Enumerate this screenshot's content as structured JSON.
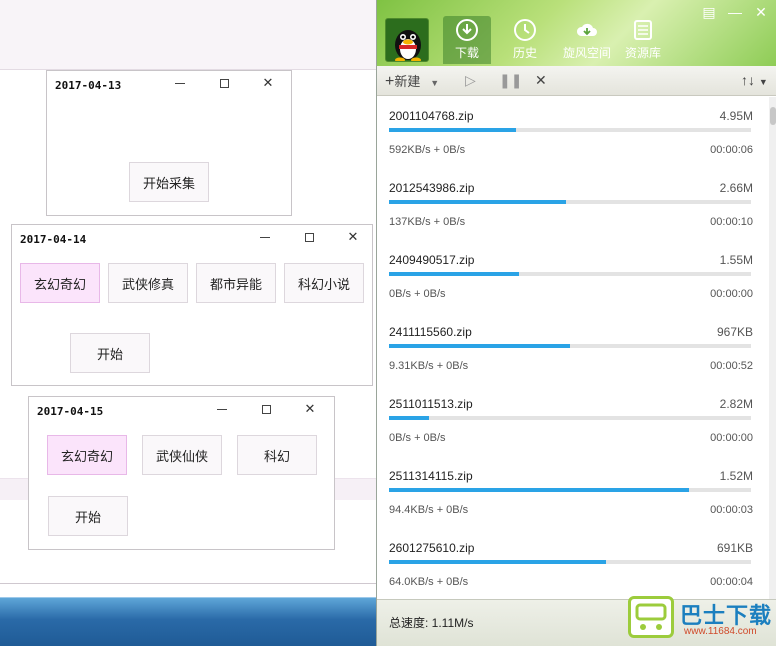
{
  "windows": [
    {
      "title": "2017-04-13",
      "buttons": [
        "开始采集"
      ]
    },
    {
      "title": "2017-04-14",
      "categories": [
        "玄幻奇幻",
        "武侠修真",
        "都市异能",
        "科幻小说"
      ],
      "start": "开始"
    },
    {
      "title": "2017-04-15",
      "categories": [
        "玄幻奇幻",
        "武侠仙侠",
        "科幻"
      ],
      "start": "开始"
    }
  ],
  "download_manager": {
    "nav": [
      {
        "label": "下载",
        "icon": "download-icon"
      },
      {
        "label": "历史",
        "icon": "clock-icon"
      },
      {
        "label": "旋风空间",
        "icon": "cloud-icon"
      },
      {
        "label": "资源库",
        "icon": "library-icon"
      }
    ],
    "toolbar": {
      "new_label": "新建",
      "sort_label": "↑↓"
    },
    "items": [
      {
        "name": "2001104768.zip",
        "size": "4.95M",
        "progress": 0.35,
        "speed": "592KB/s + 0B/s",
        "eta": "00:00:06"
      },
      {
        "name": "2012543986.zip",
        "size": "2.66M",
        "progress": 0.49,
        "speed": "137KB/s + 0B/s",
        "eta": "00:00:10"
      },
      {
        "name": "2409490517.zip",
        "size": "1.55M",
        "progress": 0.36,
        "speed": "0B/s + 0B/s",
        "eta": "00:00:00"
      },
      {
        "name": "2411115560.zip",
        "size": "967KB",
        "progress": 0.5,
        "speed": "9.31KB/s + 0B/s",
        "eta": "00:00:52"
      },
      {
        "name": "2511011513.zip",
        "size": "2.82M",
        "progress": 0.11,
        "speed": "0B/s + 0B/s",
        "eta": "00:00:00"
      },
      {
        "name": "2511314115.zip",
        "size": "1.52M",
        "progress": 0.83,
        "speed": "94.4KB/s + 0B/s",
        "eta": "00:00:03"
      },
      {
        "name": "2601275610.zip",
        "size": "691KB",
        "progress": 0.6,
        "speed": "64.0KB/s + 0B/s",
        "eta": "00:00:04"
      }
    ],
    "status": "总速度: 1.11M/s",
    "accent_color": "#2aa3e6"
  },
  "watermark": {
    "name": "巴士下载",
    "url": "www.11684.com"
  }
}
